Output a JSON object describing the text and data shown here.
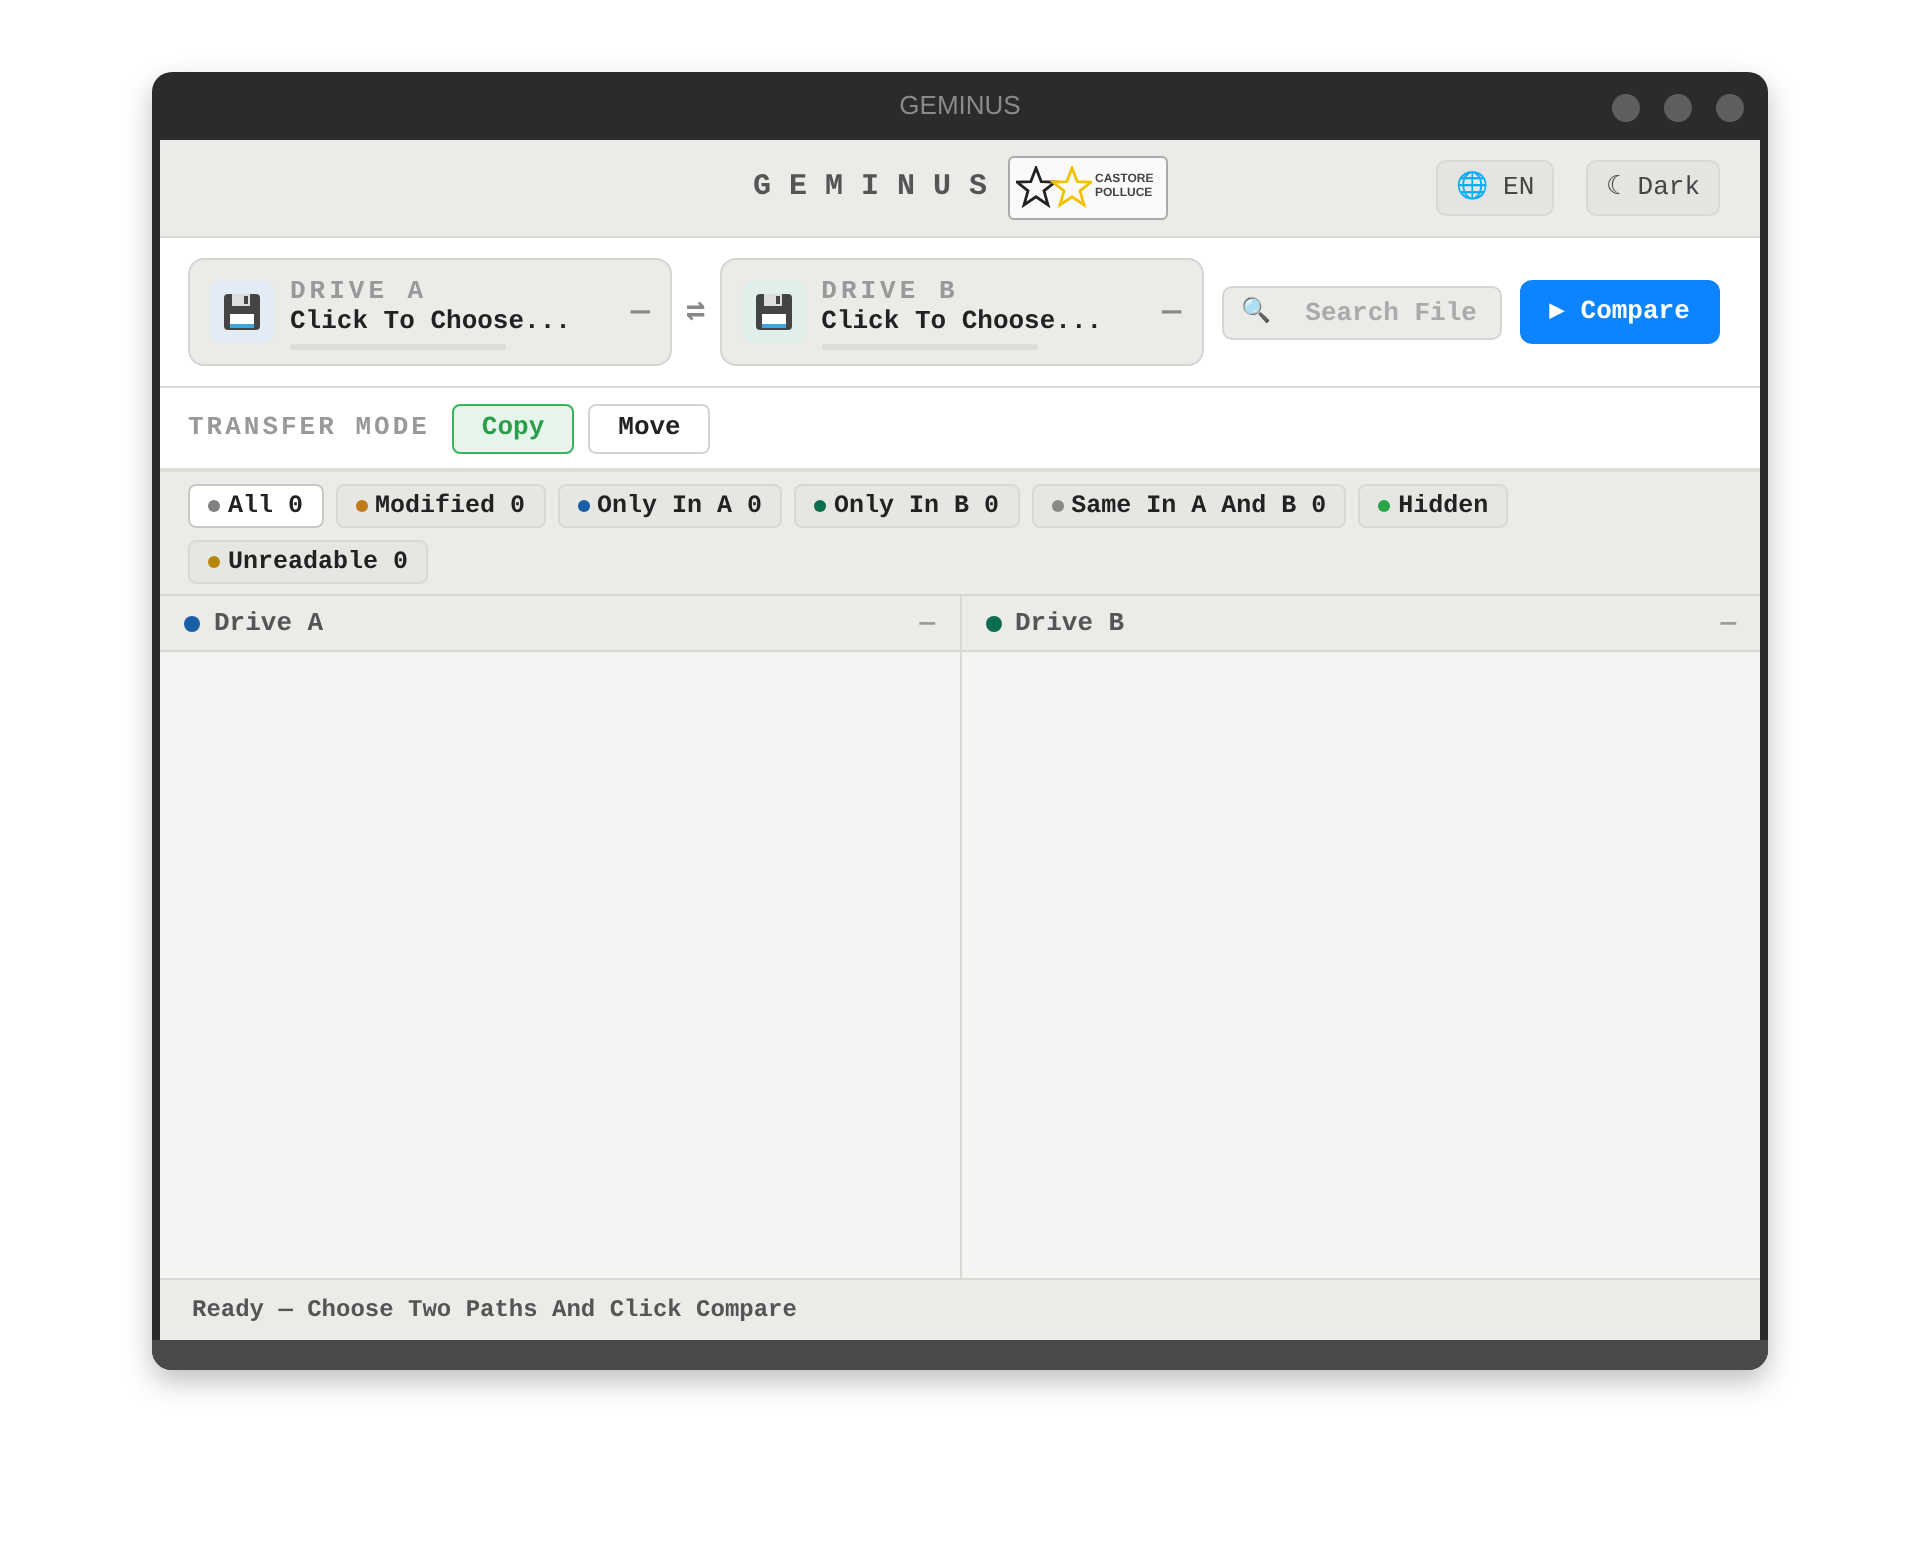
{
  "window": {
    "title": "GEMINUS"
  },
  "header": {
    "brand": "G E M I N U S",
    "logo_text": [
      "CASTORE",
      "POLLUCE"
    ],
    "language_icon": "🌐",
    "language": "EN",
    "theme_icon": "☾",
    "theme": "Dark"
  },
  "drives": [
    {
      "label": "DRIVE A",
      "path": "Click To Choose...",
      "action": "—"
    },
    {
      "label": "DRIVE B",
      "path": "Click To Choose...",
      "action": "—"
    }
  ],
  "swap": "⇌",
  "search": {
    "icon": "🔍",
    "placeholder": "Search File"
  },
  "compare": "▶ Compare",
  "transfer_mode": {
    "label": "TRANSFER MODE",
    "options": [
      {
        "label": "Copy",
        "selected": true
      },
      {
        "label": "Move",
        "selected": false
      }
    ]
  },
  "filters": [
    {
      "label": "All 0",
      "color": "#808080",
      "selected": true
    },
    {
      "label": "Modified 0",
      "color": "#c07a1c",
      "selected": false
    },
    {
      "label": "Only In A 0",
      "color": "#1a5ea8",
      "selected": false
    },
    {
      "label": "Only In B 0",
      "color": "#0d6e4f",
      "selected": false
    },
    {
      "label": "Same In A And B 0",
      "color": "#8a8a84",
      "selected": false
    },
    {
      "label": "Hidden",
      "color": "#28a745",
      "selected": false
    },
    {
      "label": "Unreadable 0",
      "color": "#b8860b",
      "selected": false
    }
  ],
  "panes": [
    {
      "title": "Drive A",
      "color": "#1a5ea8",
      "action": "—"
    },
    {
      "title": "Drive B",
      "color": "#0d6e4f",
      "action": "—"
    }
  ],
  "status_bar": "Ready — Choose Two Paths And Click Compare"
}
